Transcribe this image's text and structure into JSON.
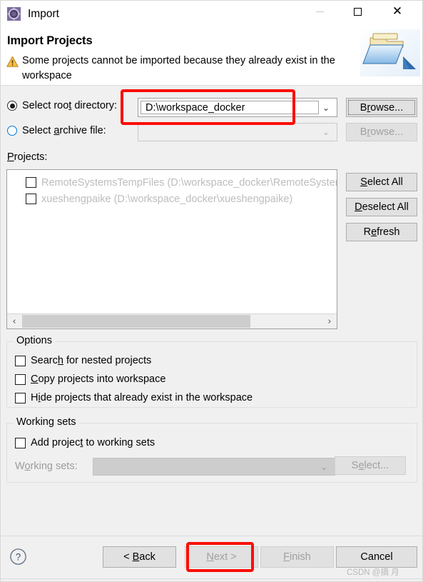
{
  "window": {
    "title": "Import",
    "app_icon": "eclipse-import-icon",
    "controls": {
      "minimize": "—",
      "maximize": "□",
      "close": "✕"
    }
  },
  "banner": {
    "page_title": "Import Projects",
    "warning_icon": "warning-triangle-icon",
    "warning_message": "Some projects cannot be imported because they already exist in the workspace",
    "art_icon": "open-folder-import-icon"
  },
  "source": {
    "root_directory": {
      "label_before": "Select roo",
      "label_mnemonic": "t",
      "label_after": " directory:",
      "selected": true,
      "value": "D:\\workspace_docker",
      "browse_label_before": "B",
      "browse_label_mnemonic": "r",
      "browse_label_after": "owse...",
      "browse_enabled": true
    },
    "archive_file": {
      "label_before": "Select ",
      "label_mnemonic": "a",
      "label_after": "rchive file:",
      "selected": false,
      "value": "",
      "browse_label_before": "B",
      "browse_label_mnemonic": "r",
      "browse_label_after": "owse...",
      "browse_enabled": false
    },
    "dropdown_chevron": "⌄"
  },
  "projects": {
    "label": "Projects:",
    "items": [
      {
        "name": "RemoteSystemsTempFiles (D:\\workspace_docker\\RemoteSystemsTempFiles)",
        "checked": false,
        "enabled": false
      },
      {
        "name": "xueshengpaike (D:\\workspace_docker\\xueshengpaike)",
        "checked": false,
        "enabled": false
      }
    ],
    "scrollbar": {
      "left_arrow": "‹",
      "right_arrow": "›"
    },
    "buttons": [
      {
        "prefix": "",
        "mnemonic": "S",
        "suffix": "elect All",
        "name": "select-all-button"
      },
      {
        "prefix": "",
        "mnemonic": "D",
        "suffix": "eselect All",
        "name": "deselect-all-button"
      },
      {
        "prefix": "R",
        "mnemonic": "e",
        "suffix": "fresh",
        "name": "refresh-button"
      }
    ]
  },
  "options": {
    "legend": "Options",
    "checkboxes": [
      {
        "prefix": "Searc",
        "mnemonic": "h",
        "suffix": " for nested projects",
        "checked": false
      },
      {
        "prefix": "",
        "mnemonic": "C",
        "suffix": "opy projects into workspace",
        "checked": false
      },
      {
        "prefix": "H",
        "mnemonic": "i",
        "suffix": "de projects that already exist in the workspace",
        "checked": false
      }
    ]
  },
  "working_sets": {
    "legend": "Working sets",
    "checkbox": {
      "prefix": "Add projec",
      "mnemonic": "t",
      "suffix": " to working sets",
      "checked": false
    },
    "field_label_prefix": "W",
    "field_label_mnemonic": "o",
    "field_label_suffix": "rking sets:",
    "field_value": "",
    "select_button": {
      "prefix": "S",
      "mnemonic": "e",
      "suffix": "lect...",
      "enabled": false
    },
    "dropdown_chevron": "⌄"
  },
  "footer": {
    "help_icon": "help-question-icon",
    "buttons": [
      {
        "prefix": "< ",
        "mnemonic": "B",
        "suffix": "ack",
        "enabled": true,
        "name": "back-button"
      },
      {
        "prefix": "",
        "mnemonic": "N",
        "suffix": "ext >",
        "enabled": false,
        "name": "next-button"
      },
      {
        "prefix": "",
        "mnemonic": "F",
        "suffix": "inish",
        "enabled": false,
        "name": "finish-button"
      },
      {
        "prefix": "Cancel",
        "mnemonic": "",
        "suffix": "",
        "enabled": true,
        "name": "cancel-button"
      }
    ],
    "watermark": "CSDN @摘 月"
  },
  "annotations": {
    "highlight_color": "#fb0d06",
    "boxes": [
      {
        "target": "root-directory-combo"
      },
      {
        "target": "next-button"
      }
    ]
  }
}
